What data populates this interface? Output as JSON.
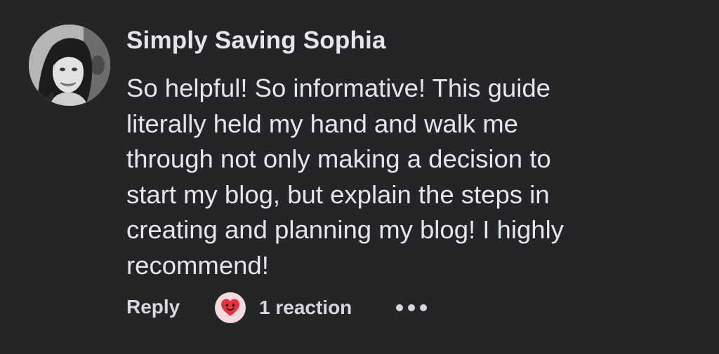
{
  "comment": {
    "author": "Simply Saving Sophia",
    "body_lines": [
      "So helpful! So informative! This guide",
      "literally held my hand and walk me",
      "through not only making a decision to",
      "start my blog, but explain the steps in",
      "creating and planning my blog! I highly",
      "recommend!"
    ],
    "actions": {
      "reply_label": "Reply",
      "reaction_count_label": "1 reaction",
      "reaction_icon": "heart-face-icon",
      "more_icon": "more-options-icon"
    }
  },
  "colors": {
    "background": "#242526",
    "text": "#e4e6eb",
    "reaction_red": "#e8333f"
  }
}
